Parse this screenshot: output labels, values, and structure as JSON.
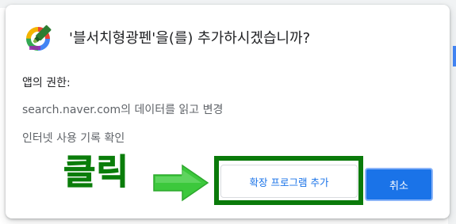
{
  "dialog": {
    "title": "'블서치형광펜'을(를) 추가하시겠습니까?",
    "permissions_heading": "앱의 권한:",
    "permissions": [
      "search.naver.com의 데이터를 읽고 변경",
      "인터넷 사용 기록 확인"
    ],
    "buttons": {
      "add_extension": "확장 프로그램 추가",
      "cancel": "취소"
    }
  },
  "annotation": {
    "label": "클릭",
    "color": "#0a7d0a",
    "arrow_color": "#3cc83c"
  },
  "colors": {
    "primary": "#1a73e8",
    "text": "#202124",
    "secondary_text": "#5f6368"
  },
  "icons": {
    "extension": "highlighter-pen-icon",
    "arrow": "right-arrow-icon"
  }
}
